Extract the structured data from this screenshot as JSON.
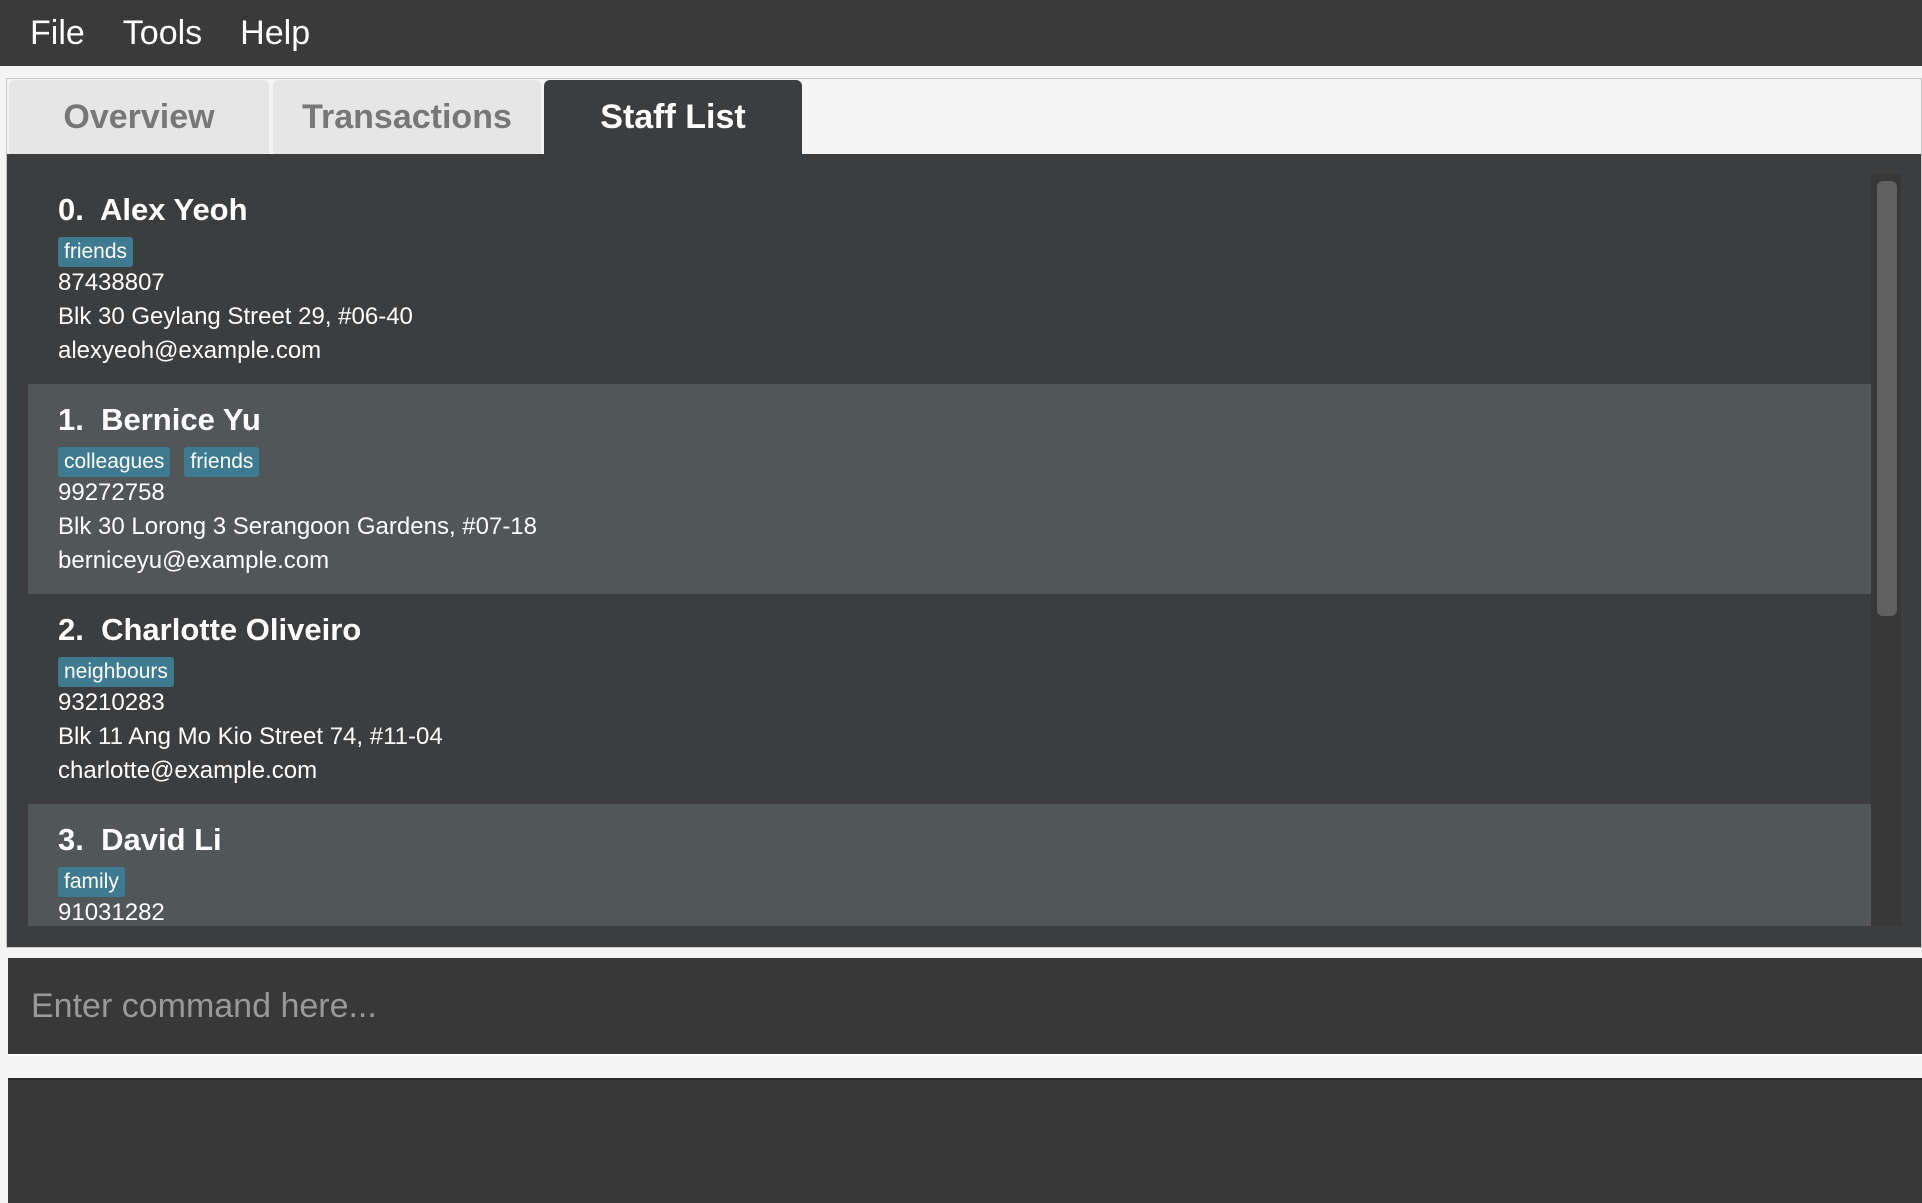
{
  "menu": [
    "File",
    "Tools",
    "Help"
  ],
  "tabs": [
    "Overview",
    "Transactions",
    "Staff List"
  ],
  "active_tab": "Staff List",
  "persons": [
    {
      "index": "0.",
      "name": "Alex Yeoh",
      "tags": [
        "friends"
      ],
      "phone": "87438807",
      "address": "Blk 30 Geylang Street 29, #06-40",
      "email": "alexyeoh@example.com"
    },
    {
      "index": "1.",
      "name": "Bernice Yu",
      "tags": [
        "colleagues",
        "friends"
      ],
      "phone": "99272758",
      "address": "Blk 30 Lorong 3 Serangoon Gardens, #07-18",
      "email": "berniceyu@example.com"
    },
    {
      "index": "2.",
      "name": "Charlotte Oliveiro",
      "tags": [
        "neighbours"
      ],
      "phone": "93210283",
      "address": "Blk 11 Ang Mo Kio Street 74, #11-04",
      "email": "charlotte@example.com"
    },
    {
      "index": "3.",
      "name": "David Li",
      "tags": [
        "family"
      ],
      "phone": "91031282",
      "address": "",
      "email": ""
    }
  ],
  "command": {
    "placeholder": "Enter command here...",
    "value": ""
  },
  "result": "",
  "colors": {
    "tag": "#3e7b91",
    "row": "#3c3d3f",
    "row_alt": "#515658",
    "menubar": "#3a3a3a"
  }
}
